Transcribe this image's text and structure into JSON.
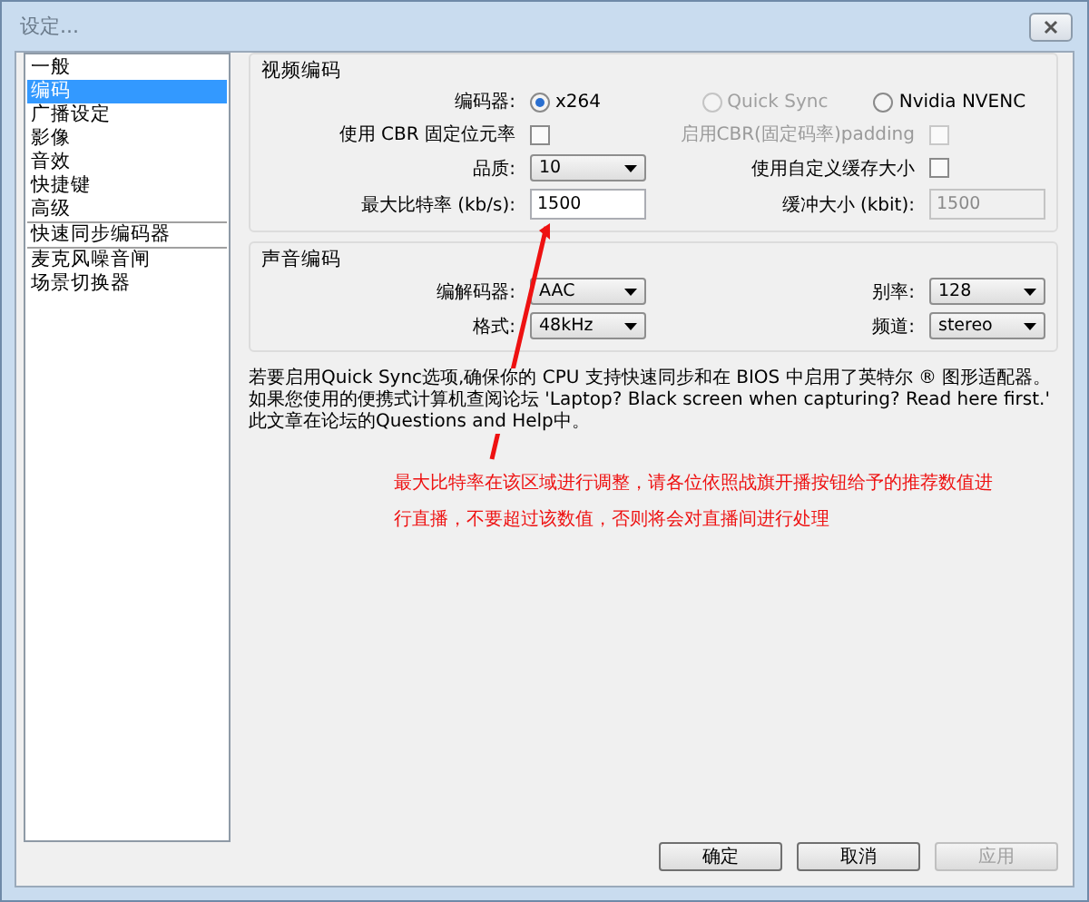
{
  "window": {
    "title": "设定..."
  },
  "sidebar": {
    "items": [
      {
        "label": "一般",
        "selected": false,
        "separator_after": false
      },
      {
        "label": "编码",
        "selected": true,
        "separator_after": false
      },
      {
        "label": "广播设定",
        "selected": false,
        "separator_after": false
      },
      {
        "label": "影像",
        "selected": false,
        "separator_after": false
      },
      {
        "label": "音效",
        "selected": false,
        "separator_after": false
      },
      {
        "label": "快捷键",
        "selected": false,
        "separator_after": false
      },
      {
        "label": "高级",
        "selected": false,
        "separator_after": true
      },
      {
        "label": "快速同步编码器",
        "selected": false,
        "separator_after": true
      },
      {
        "label": "麦克风噪音闸",
        "selected": false,
        "separator_after": false
      },
      {
        "label": "场景切换器",
        "selected": false,
        "separator_after": false
      }
    ]
  },
  "video": {
    "title": "视频编码",
    "encoder_label": "编码器:",
    "encoders": [
      {
        "label": "x264",
        "selected": true,
        "disabled": false
      },
      {
        "label": "Quick Sync",
        "selected": false,
        "disabled": true
      },
      {
        "label": "Nvidia NVENC",
        "selected": false,
        "disabled": false
      }
    ],
    "rows": [
      {
        "left": {
          "kind": "checkbox",
          "label": "使用 CBR 固定位元率",
          "checked": false,
          "disabled": false
        },
        "right": {
          "kind": "checkbox",
          "label": "启用CBR(固定码率)padding",
          "checked": false,
          "disabled": true
        }
      },
      {
        "left": {
          "kind": "select",
          "label": "品质:",
          "value": "10",
          "disabled": false
        },
        "right": {
          "kind": "checkbox",
          "label": "使用自定义缓存大小",
          "checked": false,
          "disabled": false
        }
      },
      {
        "left": {
          "kind": "input",
          "label": "最大比特率 (kb/s):",
          "value": "1500",
          "disabled": false
        },
        "right": {
          "kind": "input",
          "label": "缓冲大小 (kbit):",
          "value": "1500",
          "disabled": true
        }
      }
    ]
  },
  "audio": {
    "title": "声音编码",
    "rows": [
      {
        "left": {
          "kind": "select",
          "label": "编解码器:",
          "value": "AAC",
          "disabled": false
        },
        "right": {
          "kind": "select",
          "label": "别率:",
          "value": "128",
          "disabled": false
        }
      },
      {
        "left": {
          "kind": "select",
          "label": "格式:",
          "value": "48kHz",
          "disabled": false
        },
        "right": {
          "kind": "select",
          "label": "频道:",
          "value": "stereo",
          "disabled": false
        }
      }
    ]
  },
  "note": "若要启用Quick Sync选项,确保你的 CPU 支持快速同步和在 BIOS 中启用了英特尔 ® 图形适配器。如果您使用的便携式计算机查阅论坛 'Laptop? Black screen when capturing? Read here first.' 此文章在论坛的Questions and Help中。",
  "annotation": {
    "lines": [
      "最大比特率在该区域进行调整，请各位依照战旗开播按钮给予的推荐数值进",
      "行直播，不要超过该数值，否则将会对直播间进行处理"
    ]
  },
  "buttons": [
    {
      "label": "确定",
      "disabled": false
    },
    {
      "label": "取消",
      "disabled": false
    },
    {
      "label": "应用",
      "disabled": true
    }
  ]
}
